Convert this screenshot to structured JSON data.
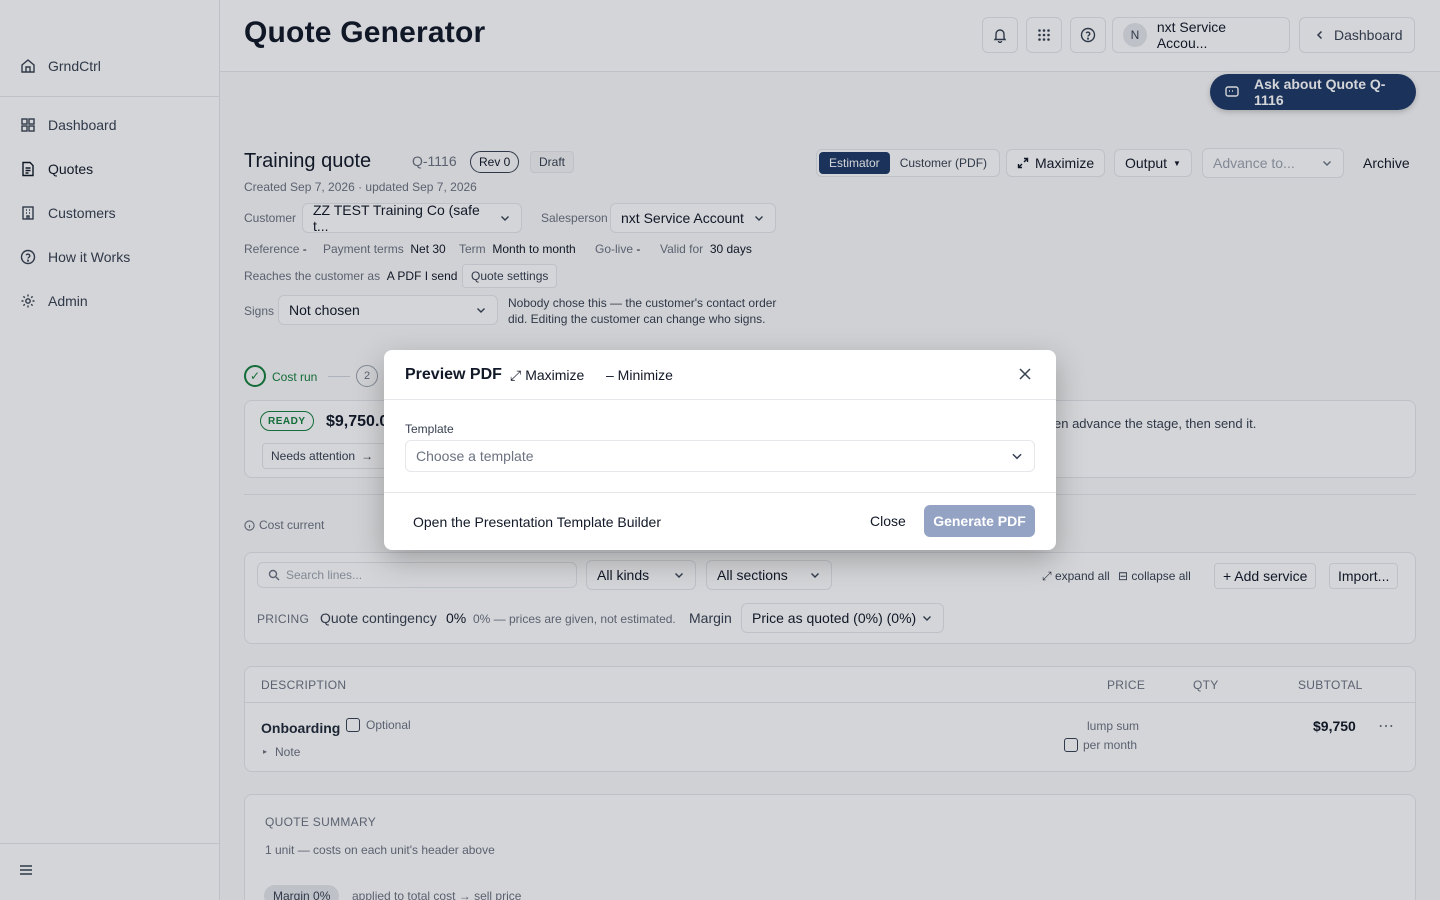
{
  "app": {
    "brand": "GrndCtrl"
  },
  "sidebar": {
    "items": [
      {
        "label": "Dashboard"
      },
      {
        "label": "Quotes"
      },
      {
        "label": "Customers"
      },
      {
        "label": "How it Works"
      },
      {
        "label": "Admin"
      }
    ]
  },
  "header": {
    "title": "Quote Generator",
    "account_initial": "N",
    "account_name": "nxt Service Accou...",
    "dashboard_label": "Dashboard"
  },
  "assistant": {
    "ask_label": "Ask about Quote Q-1116"
  },
  "quote": {
    "name": "Training quote",
    "id": "Q-1116",
    "rev": "Rev 0",
    "status": "Draft",
    "created": "Created Sep 7, 2026 · updated Sep 7, 2026",
    "customer_label": "Customer",
    "customer_value": "ZZ TEST Training Co (safe t...",
    "salesperson_label": "Salesperson",
    "salesperson_value": "nxt Service Account",
    "reference_label": "Reference",
    "reference_value": "-",
    "payment_label": "Payment terms",
    "payment_value": "Net 30",
    "term_label": "Term",
    "term_value": "Month to month",
    "golive_label": "Go-live",
    "golive_value": "-",
    "valid_label": "Valid for",
    "valid_value": "30 days",
    "reaches_label": "Reaches the customer as",
    "reaches_value": "A PDF I send",
    "settings_label": "Quote settings",
    "signs_label": "Signs",
    "signs_value": "Not chosen",
    "signs_note": "Nobody chose this — the customer's contact order did. Editing the customer can change who signs."
  },
  "toolbar": {
    "view_estimator": "Estimator",
    "view_customer": "Customer (PDF)",
    "maximize": "Maximize",
    "output": "Output",
    "advance_placeholder": "Advance to...",
    "archive": "Archive"
  },
  "stages": {
    "step1_label": "Cost run",
    "step2_number": "2"
  },
  "status_card": {
    "ready": "READY",
    "amount": "$9,750.0",
    "needs_attention": "Needs attention",
    "hint": "en advance the stage, then send it."
  },
  "cost_current": "Cost current",
  "filters": {
    "search_placeholder": "Search lines...",
    "kinds": "All kinds",
    "sections": "All sections",
    "expand_all": "expand all",
    "collapse_all": "collapse all",
    "add_service": "+ Add service",
    "import": "Import..."
  },
  "pricing": {
    "label": "PRICING",
    "contingency_label": "Quote contingency",
    "contingency_value": "0%",
    "contingency_note": "0% — prices are given, not estimated.",
    "margin_label": "Margin",
    "margin_value": "Price as quoted (0%) (0%)"
  },
  "table": {
    "headers": {
      "description": "DESCRIPTION",
      "price": "PRICE",
      "qty": "QTY",
      "subtotal": "SUBTOTAL"
    },
    "rows": [
      {
        "name": "Onboarding",
        "optional": "Optional",
        "note": "Note",
        "price_type": "lump sum",
        "per_month": "per month",
        "subtotal": "$9,750"
      }
    ]
  },
  "summary": {
    "title": "QUOTE SUMMARY",
    "units": "1 unit — costs on each unit's header above",
    "margin_chip": "Margin 0%",
    "margin_note": "applied to total cost → sell price"
  },
  "modal": {
    "title": "Preview PDF",
    "maximize": "Maximize",
    "minimize": "– Minimize",
    "template_label": "Template",
    "template_placeholder": "Choose a template",
    "open_builder": "Open the Presentation Template Builder",
    "close": "Close",
    "generate": "Generate PDF"
  },
  "colors": {
    "accent": "#1e3a66",
    "success": "#15803d",
    "generate_disabled": "#94a3c4"
  }
}
